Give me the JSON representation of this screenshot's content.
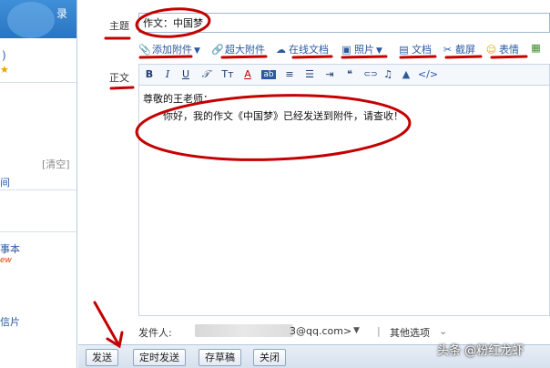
{
  "sidebar": {
    "login_fragment": "录",
    "count_fragment": ")",
    "star": "★",
    "clear_label": "[清空]",
    "items": [
      {
        "label": "间"
      },
      {
        "label": "事本"
      },
      {
        "label": "信片"
      }
    ],
    "new_badge": "ew"
  },
  "compose": {
    "subject_label": "主题",
    "subject_value": "作文：中国梦",
    "body_label": "正文",
    "greeting": "尊敬的王老师：",
    "content": "你好，我的作文《中国梦》已经发送到附件，请查收！",
    "sender_label": "发件人:",
    "sender_suffix": "3@qq.com>",
    "sender_dropdown": "▼",
    "separator": "|",
    "other_options": "其他选项",
    "other_options_icon": "chevron-double-down-icon"
  },
  "attach_bar": [
    {
      "icon": "paperclip-icon",
      "glyph": "📎",
      "label": "添加附件",
      "dropdown": true
    },
    {
      "icon": "large-attachment-icon",
      "glyph": "🔗",
      "label": "超大附件",
      "dropdown": false
    },
    {
      "icon": "online-doc-icon",
      "glyph": "☁",
      "label": "在线文档",
      "dropdown": false
    },
    {
      "icon": "photo-icon",
      "glyph": "▣",
      "label": "照片",
      "dropdown": true
    },
    {
      "icon": "document-icon",
      "glyph": "▤",
      "label": "文档",
      "dropdown": false
    },
    {
      "icon": "screenshot-icon",
      "glyph": "✂",
      "label": "截屏",
      "dropdown": false
    },
    {
      "icon": "emoji-icon",
      "glyph": "☺",
      "label": "表情",
      "dropdown": false
    },
    {
      "icon": "more-apps-icon",
      "glyph": "▦",
      "label": "",
      "dropdown": false
    }
  ],
  "format_bar": [
    {
      "icon": "bold-icon",
      "glyph": "B"
    },
    {
      "icon": "italic-icon",
      "glyph": "I"
    },
    {
      "icon": "underline-icon",
      "glyph": "U"
    },
    {
      "icon": "clear-format-icon",
      "glyph": "𝒯"
    },
    {
      "icon": "font-size-icon",
      "glyph": "Tᴛ"
    },
    {
      "icon": "font-color-icon",
      "glyph": "A"
    },
    {
      "icon": "highlight-icon",
      "glyph": "ab"
    },
    {
      "icon": "align-icon",
      "glyph": "≡"
    },
    {
      "icon": "ordered-list-icon",
      "glyph": "☰"
    },
    {
      "icon": "indent-icon",
      "glyph": "⇥"
    },
    {
      "icon": "quote-icon",
      "glyph": "❝"
    },
    {
      "icon": "link-icon",
      "glyph": "⊂⊃"
    },
    {
      "icon": "music-icon",
      "glyph": "♫"
    },
    {
      "icon": "paint-icon",
      "glyph": "▲"
    },
    {
      "icon": "source-code-icon",
      "glyph": "</>"
    }
  ],
  "buttons": {
    "send": "发送",
    "scheduled_send": "定时发送",
    "save_draft": "存草稿",
    "close": "关闭"
  },
  "watermark": "头条 @粉红龙虾",
  "colors": {
    "annotation": "#c40000",
    "link": "#2a5aa0",
    "header_blue": "#2a74c2"
  }
}
